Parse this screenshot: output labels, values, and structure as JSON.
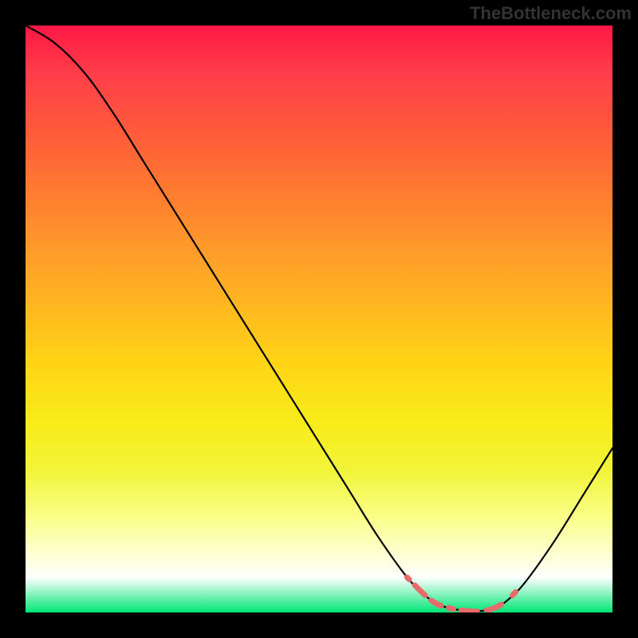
{
  "watermark": "TheBottleneck.com",
  "colors": {
    "curve": "#000000",
    "dash": "#e86a6a",
    "bg_top": "#ff1744",
    "bg_bottom": "#00e676"
  },
  "chart_data": {
    "type": "line",
    "title": "",
    "xlabel": "",
    "ylabel": "",
    "xlim": [
      0,
      100
    ],
    "ylim": [
      0,
      100
    ],
    "x": [
      0,
      5,
      10,
      15,
      20,
      25,
      30,
      35,
      40,
      45,
      50,
      55,
      60,
      65,
      68,
      70,
      72,
      74,
      76,
      78,
      80,
      82,
      85,
      90,
      95,
      100
    ],
    "series": [
      {
        "name": "curve",
        "values": [
          100,
          97,
          92,
          85,
          77,
          69,
          61,
          53,
          45,
          37,
          29,
          21,
          13,
          6,
          3,
          1.5,
          0.8,
          0.4,
          0.2,
          0.3,
          0.8,
          2,
          5,
          12,
          20,
          28
        ]
      }
    ],
    "dash_segment": {
      "x": [
        65,
        68,
        70,
        72,
        74,
        76,
        78,
        80,
        82,
        83.5
      ],
      "y": [
        6,
        3,
        1.5,
        0.8,
        0.4,
        0.2,
        0.3,
        0.8,
        2,
        3.5
      ]
    }
  }
}
